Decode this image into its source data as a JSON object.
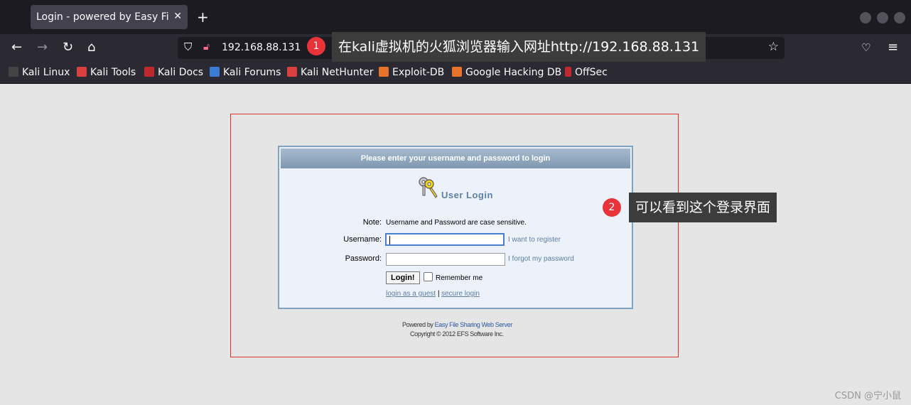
{
  "browser": {
    "tab_title": "Login - powered by Easy File",
    "tab_close": "✕",
    "new_tab": "+",
    "url": "192.168.88.131",
    "nav": {
      "back": "←",
      "forward": "→",
      "reload": "↻",
      "home": "⌂"
    },
    "bookmarks": [
      {
        "label": "Kali Linux",
        "color": "#444444"
      },
      {
        "label": "Kali Tools",
        "color": "#d94040"
      },
      {
        "label": "Kali Docs",
        "color": "#c0282d"
      },
      {
        "label": "Kali Forums",
        "color": "#3a7bd5"
      },
      {
        "label": "Kali NetHunter",
        "color": "#d94040"
      },
      {
        "label": "Exploit-DB",
        "color": "#e8732a"
      },
      {
        "label": "Google Hacking DB",
        "color": "#e8732a"
      },
      {
        "label": "OffSec",
        "color": "#c0282d"
      }
    ]
  },
  "annotations": {
    "step1_number": "1",
    "step1_text": "在kali虚拟机的火狐浏览器输入网址http://192.168.88.131",
    "step2_number": "2",
    "step2_text": "可以看到这个登录界面"
  },
  "login": {
    "header": "Please enter your username and password to login",
    "title": "User Login",
    "note_label": "Note:",
    "note_text": "Username and Password are case sensitive.",
    "username_label": "Username:",
    "password_label": "Password:",
    "register_link": "I want to register",
    "forgot_link": "I forgot my password",
    "login_button": "Login!",
    "remember_label": "Remember me",
    "guest_link": "login as a guest",
    "separator": "|",
    "secure_link": "secure login"
  },
  "footer": {
    "powered_prefix": "Powered by",
    "powered_link": "Easy File Sharing Web Server",
    "copyright": "Copyright © 2012 EFS Software Inc."
  },
  "watermark": "CSDN @宁小鼠"
}
